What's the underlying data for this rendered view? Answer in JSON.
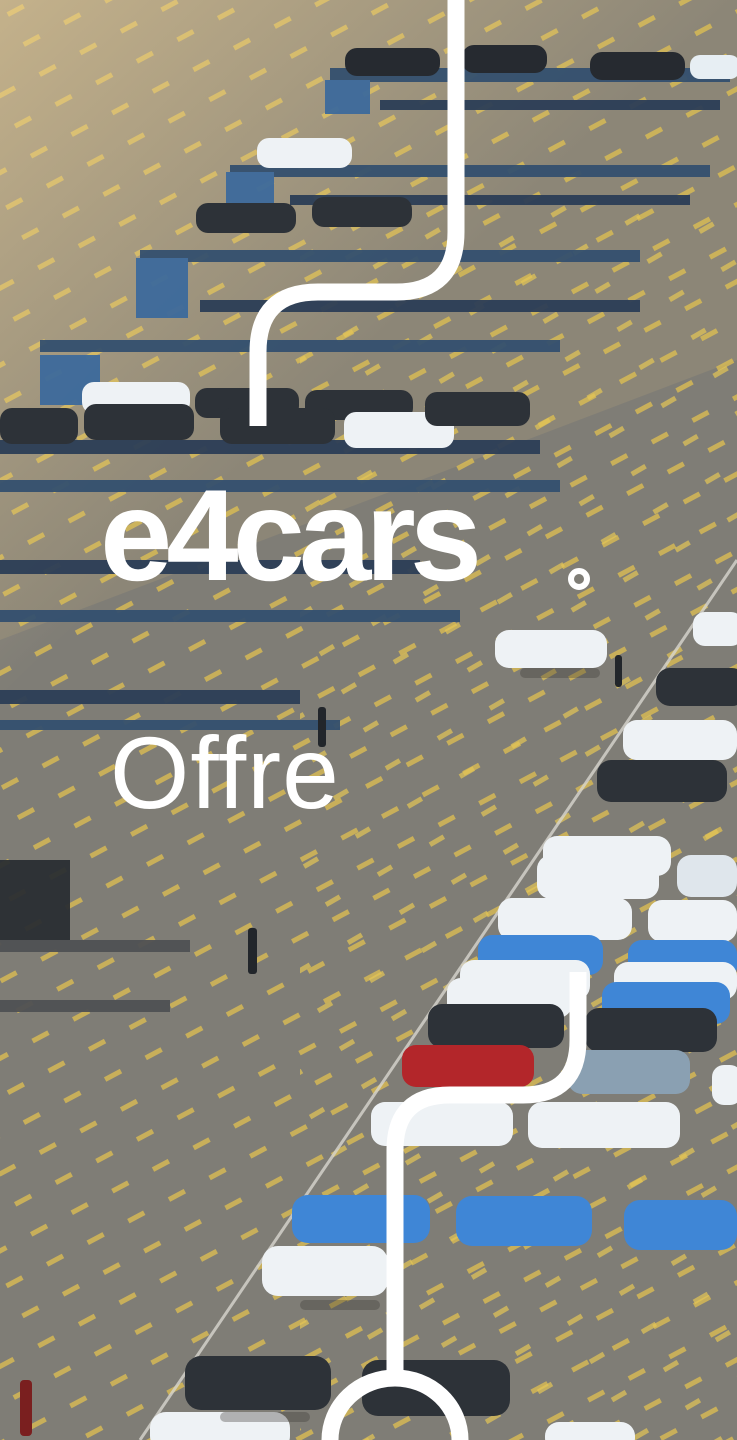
{
  "brand": {
    "logo_text": "e4cars"
  },
  "page": {
    "title": "Offre"
  },
  "colors": {
    "logo": "#ffffff",
    "title": "#ffffff",
    "route_line": "#ffffff",
    "asphalt": "#7a7a76",
    "parking_lines": "#e3c34a",
    "car_white": "#eef2f5",
    "car_blue": "#3f86d6",
    "car_dark": "#2b2f35",
    "car_red": "#b3262a",
    "truck_blue": "#2f4f78"
  },
  "icons": {
    "route_line": "route-line-icon",
    "logo_dot": "logo-ring-icon"
  }
}
